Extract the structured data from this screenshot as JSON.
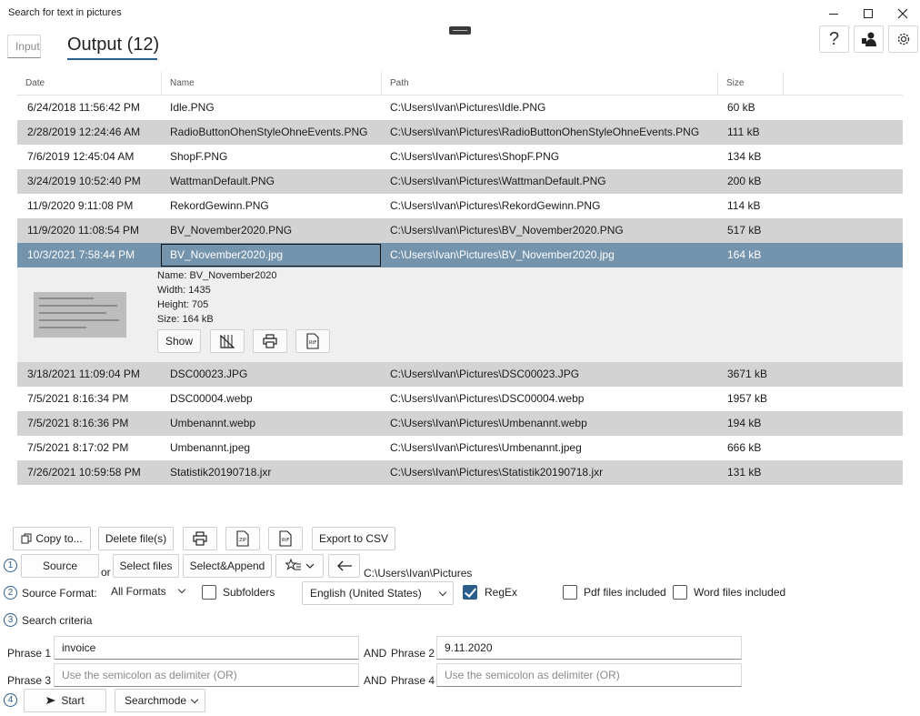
{
  "window": {
    "title": "Search for text in pictures"
  },
  "tabs": {
    "input": "Input",
    "output": "Output (12)"
  },
  "table": {
    "headers": [
      "Date",
      "Name",
      "Path",
      "Size"
    ],
    "rows": [
      {
        "date": "6/24/2018 11:56:42 PM",
        "name": "Idle.PNG",
        "path": "C:\\Users\\Ivan\\Pictures\\Idle.PNG",
        "size": "60 kB"
      },
      {
        "date": "2/28/2019 12:24:46 AM",
        "name": "RadioButtonOhenStyleOhneEvents.PNG",
        "path": "C:\\Users\\Ivan\\Pictures\\RadioButtonOhenStyleOhneEvents.PNG",
        "size": "111 kB"
      },
      {
        "date": "7/6/2019 12:45:04 AM",
        "name": "ShopF.PNG",
        "path": "C:\\Users\\Ivan\\Pictures\\ShopF.PNG",
        "size": "134 kB"
      },
      {
        "date": "3/24/2019 10:52:40 PM",
        "name": "WattmanDefault.PNG",
        "path": "C:\\Users\\Ivan\\Pictures\\WattmanDefault.PNG",
        "size": "200 kB"
      },
      {
        "date": "11/9/2020 9:11:08 PM",
        "name": "RekordGewinn.PNG",
        "path": "C:\\Users\\Ivan\\Pictures\\RekordGewinn.PNG",
        "size": "114 kB"
      },
      {
        "date": "11/9/2020 11:08:54 PM",
        "name": "BV_November2020.PNG",
        "path": "C:\\Users\\Ivan\\Pictures\\BV_November2020.PNG",
        "size": "517 kB"
      },
      {
        "date": "10/3/2021 7:58:44 PM",
        "name": "BV_November2020.jpg",
        "path": "C:\\Users\\Ivan\\Pictures\\BV_November2020.jpg",
        "size": "164 kB"
      },
      {
        "date": "3/18/2021 11:09:04 PM",
        "name": "DSC00023.JPG",
        "path": "C:\\Users\\Ivan\\Pictures\\DSC00023.JPG",
        "size": "3671 kB"
      },
      {
        "date": "7/5/2021 8:16:34 PM",
        "name": "DSC00004.webp",
        "path": "C:\\Users\\Ivan\\Pictures\\DSC00004.webp",
        "size": "1957 kB"
      },
      {
        "date": "7/5/2021 8:16:36 PM",
        "name": "Umbenannt.webp",
        "path": "C:\\Users\\Ivan\\Pictures\\Umbenannt.webp",
        "size": "194 kB"
      },
      {
        "date": "7/5/2021 8:17:02 PM",
        "name": "Umbenannt.jpeg",
        "path": "C:\\Users\\Ivan\\Pictures\\Umbenannt.jpeg",
        "size": "666 kB"
      },
      {
        "date": "7/26/2021 10:59:58 PM",
        "name": "Statistik20190718.jxr",
        "path": "C:\\Users\\Ivan\\Pictures\\Statistik20190718.jxr",
        "size": "131 kB"
      }
    ],
    "selected_index": 6
  },
  "details": {
    "name": "Name: BV_November2020",
    "width": "Width: 1435",
    "height": "Height: 705",
    "size": "Size: 164 kB",
    "show_label": "Show"
  },
  "actions": {
    "copy_to": "Copy to...",
    "delete_files": "Delete file(s)",
    "export_csv": "Export to CSV"
  },
  "step1": {
    "num": "1",
    "source": "Source",
    "or": "or",
    "select_files": "Select files",
    "select_append": "Select&Append",
    "path": "C:\\Users\\Ivan\\Pictures"
  },
  "step2": {
    "num": "2",
    "label": "Source Format:",
    "format": "All Formats",
    "subfolders": "Subfolders",
    "language": "English (United States)",
    "regex": "RegEx",
    "pdf": "Pdf files included",
    "word": "Word files included"
  },
  "step3": {
    "num": "3",
    "label": "Search criteria",
    "phrase1_label": "Phrase 1",
    "phrase1_value": "invoice",
    "and1": "AND",
    "phrase2_label": "Phrase 2",
    "phrase2_value": "9.11.2020",
    "phrase3_label": "Phrase 3",
    "phrase3_placeholder": "Use the semicolon as delimiter (OR)",
    "and2": "AND",
    "phrase4_label": "Phrase 4",
    "phrase4_placeholder": "Use the semicolon as delimiter (OR)"
  },
  "step4": {
    "num": "4",
    "start": "Start",
    "searchmode": "Searchmode"
  },
  "colors": {
    "accent": "#2b5d8a",
    "selected_row": "#7493ad",
    "alt_row": "#d3d3d3"
  }
}
